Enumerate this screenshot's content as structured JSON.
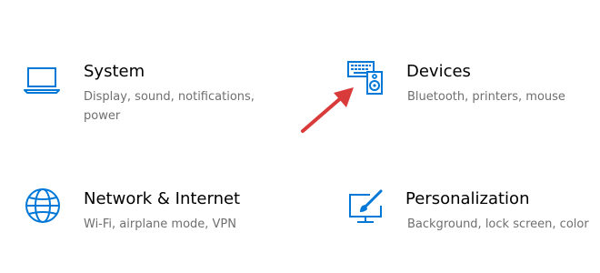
{
  "accent_color": "#0078d7",
  "annotation_color": "#d93a3a",
  "tiles": [
    {
      "title": "System",
      "description": "Display, sound, notifications, power",
      "icon": "laptop-icon"
    },
    {
      "title": "Devices",
      "description": "Bluetooth, printers, mouse",
      "icon": "keyboard-speaker-icon"
    },
    {
      "title": "Network & Internet",
      "description": "Wi-Fi, airplane mode, VPN",
      "icon": "globe-icon"
    },
    {
      "title": "Personalization",
      "description": "Background, lock screen, color",
      "icon": "paint-screen-icon"
    }
  ],
  "annotation": {
    "icon": "red-arrow-icon"
  }
}
